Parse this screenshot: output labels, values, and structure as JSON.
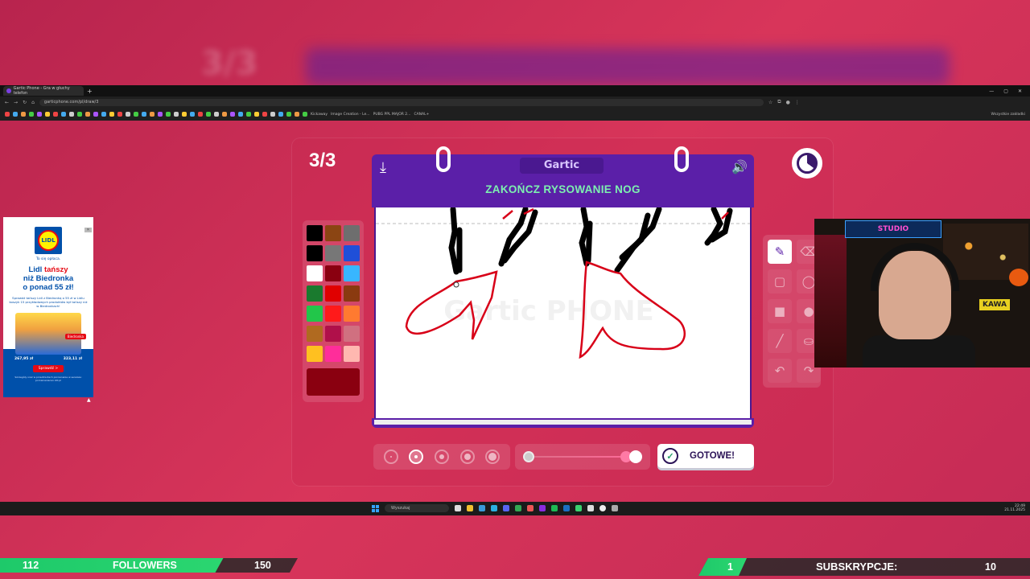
{
  "browser": {
    "tab_title": "Gartic Phone - Gra w głuchy telefon",
    "url": "garticphone.com/pl/draw/3",
    "bookmarks": [
      "Kickaway",
      "Image Creation - Le...",
      "PUBG PPL MAJOR 2...",
      "CANAL+"
    ],
    "bookmarks_right": "Wszystkie zakładki"
  },
  "game": {
    "round": "3/3",
    "logo": "Gartic",
    "prompt": "ZAKOŃCZ RYSOWANIE NOG",
    "done_label": "GOTOWE!",
    "watermark": "Gartic PHONE",
    "brush_sizes": 5,
    "active_brush_size_index": 1,
    "opacity_level": 0.9,
    "palette": [
      "#000000",
      "#8b4513",
      "#6e6e6e",
      "#000000",
      "#777777",
      "#1f4fd8",
      "#ffffff",
      "#8a0010",
      "#38b6ff",
      "#1a7a2e",
      "#e00000",
      "#8a3a10",
      "#22c64a",
      "#ff1a1a",
      "#ff7a30",
      "#b06a20",
      "#b0104a",
      "#d07080",
      "#ffc020",
      "#ff2d9a",
      "#ffb8b0"
    ],
    "current_color": "#8a0010"
  },
  "ad": {
    "tagline": "To się opłaca.",
    "headline_1": "Lidl",
    "headline_2": "tańszy",
    "headline_3": "niż Biedronka",
    "headline_4": "o ponad 55 zł!",
    "body": "Sprawdź tańszy Lidl z Biedronką o 55 zł w Lidlu koszyk 15 przykładowych produktów był tańszy niż w Biedronkach!",
    "badge": "Biedronka",
    "price_left": "267,95 zł",
    "price_right": "323,11 zł",
    "cta": "Sprawdź >",
    "fine_print": "Szczegóły oraz w przedmiotach porownanie w serwisie: porownaniecen.lidl.pl"
  },
  "webcam": {
    "neon_sign": "STUDIO",
    "mug_label": "KAWA"
  },
  "taskbar": {
    "search": "Wyszukaj",
    "time": "22:49",
    "date": "21.11.2025"
  },
  "stream": {
    "followers_current": "112",
    "followers_label": "FOLLOWERS",
    "followers_goal": "150",
    "followers_progress": 0.75,
    "subs_current": "1",
    "subs_label": "SUBSKRYPCJE:",
    "subs_goal": "10",
    "subs_progress": 0.1
  }
}
